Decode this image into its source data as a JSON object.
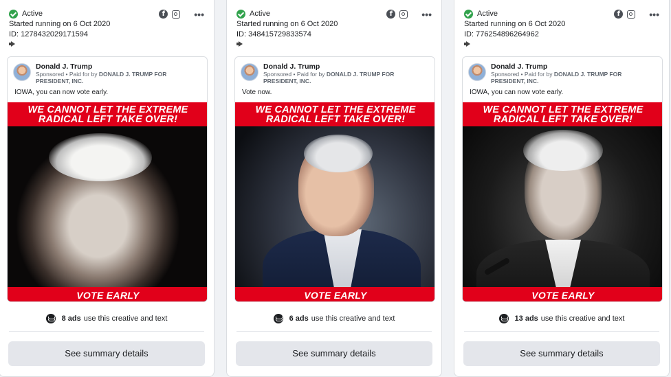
{
  "colors": {
    "accent_red": "#e1001a",
    "active_green": "#31a24c",
    "button_bg": "#e4e6eb"
  },
  "cards": [
    {
      "status": "Active",
      "started": "Started running on 6 Oct 2020",
      "id": "ID: 1278432029171594",
      "advertiser": "Donald J. Trump",
      "sponsored_prefix": "Sponsored • Paid for by ",
      "sponsored_payer": "DONALD J. TRUMP FOR PRESIDENT, INC.",
      "caption": "IOWA, you can now vote early.",
      "banner_line1": "WE CANNOT LET THE EXTREME",
      "banner_line2": "RADICAL LEFT TAKE OVER!",
      "bottom_banner": "VOTE EARLY",
      "ads_count": "8 ads",
      "ads_suffix": "use this creative and text",
      "button": "See summary details"
    },
    {
      "status": "Active",
      "started": "Started running on 6 Oct 2020",
      "id": "ID: 348415729833574",
      "advertiser": "Donald J. Trump",
      "sponsored_prefix": "Sponsored • Paid for by ",
      "sponsored_payer": "DONALD J. TRUMP FOR PRESIDENT, INC.",
      "caption": "Vote now.",
      "banner_line1": "WE CANNOT LET THE EXTREME",
      "banner_line2": "RADICAL LEFT TAKE OVER!",
      "bottom_banner": "VOTE EARLY",
      "ads_count": "6 ads",
      "ads_suffix": "use this creative and text",
      "button": "See summary details"
    },
    {
      "status": "Active",
      "started": "Started running on 6 Oct 2020",
      "id": "ID: 776254896264962",
      "advertiser": "Donald J. Trump",
      "sponsored_prefix": "Sponsored • Paid for by ",
      "sponsored_payer": "DONALD J. TRUMP FOR PRESIDENT, INC.",
      "caption": "IOWA, you can now vote early.",
      "banner_line1": "WE CANNOT LET THE EXTREME",
      "banner_line2": "RADICAL LEFT TAKE OVER!",
      "bottom_banner": "VOTE EARLY",
      "ads_count": "13 ads",
      "ads_suffix": "use this creative and text",
      "button": "See summary details"
    }
  ],
  "icons": [
    "check-circle-icon",
    "facebook-icon",
    "instagram-icon",
    "more-options-icon",
    "megaphone-icon",
    "layers-icon"
  ]
}
